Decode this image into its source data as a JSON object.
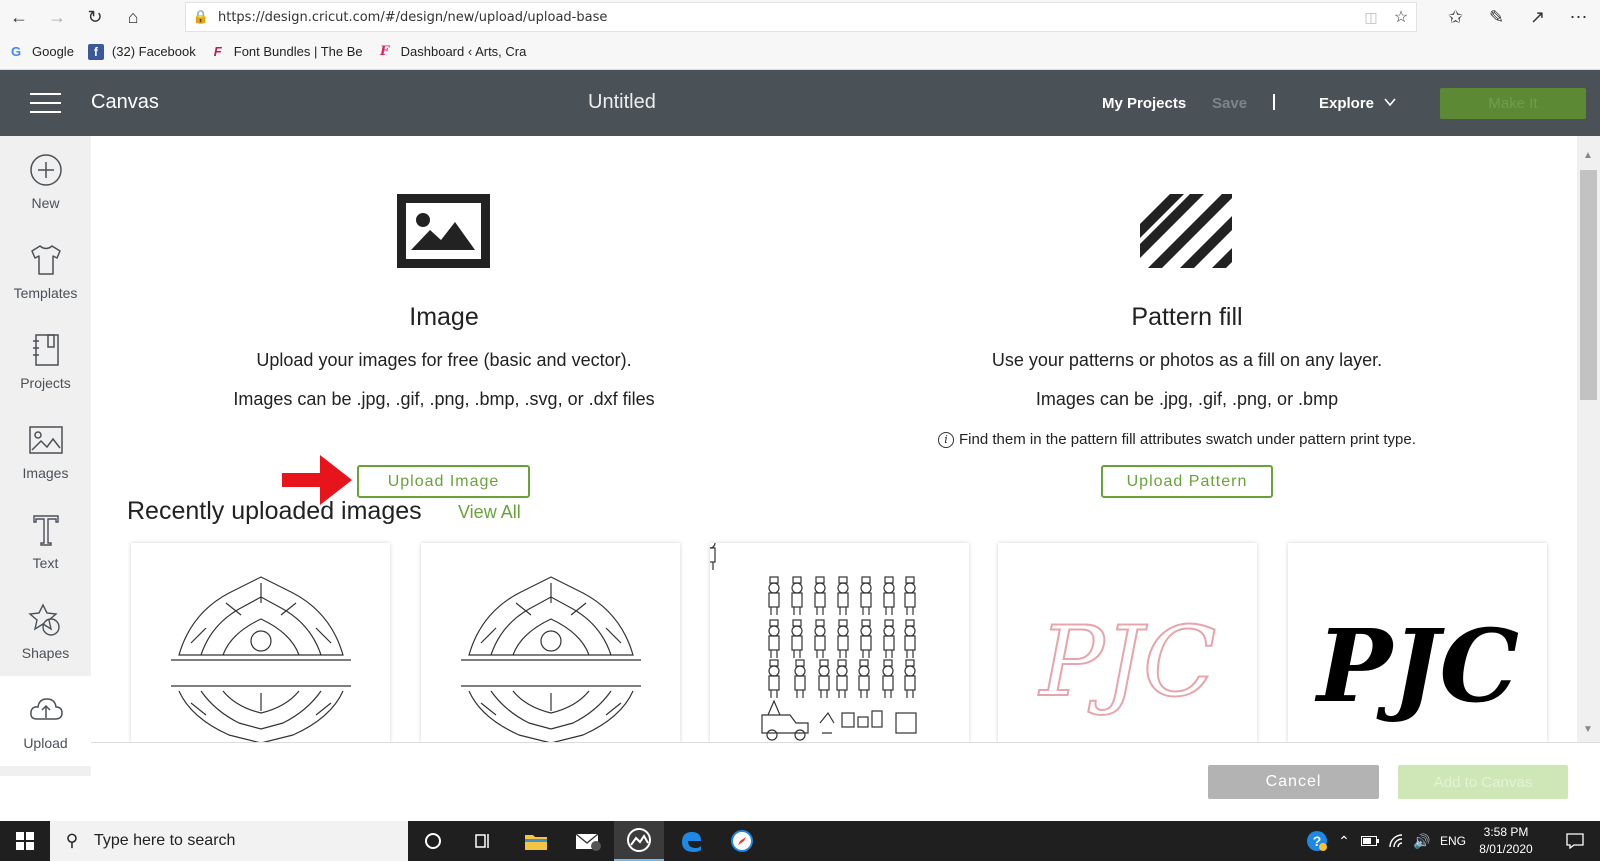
{
  "browser": {
    "url": "https://design.cricut.com/#/design/new/upload/upload-base",
    "bookmarks": [
      {
        "label": "Google",
        "icon": "google-icon"
      },
      {
        "label": "(32) Facebook",
        "icon": "facebook-icon"
      },
      {
        "label": "Font Bundles | The Be",
        "icon": "fontbundles-icon"
      },
      {
        "label": "Dashboard ‹ Arts, Cra",
        "icon": "wordpress-dashboard-icon"
      }
    ]
  },
  "header": {
    "app_title": "Canvas",
    "doc_title": "Untitled",
    "my_projects": "My Projects",
    "save": "Save",
    "separator": "|",
    "explore": "Explore",
    "make_it": "Make It"
  },
  "sidebar": {
    "items": [
      {
        "label": "New",
        "icon": "plus-circle-icon"
      },
      {
        "label": "Templates",
        "icon": "tshirt-icon"
      },
      {
        "label": "Projects",
        "icon": "notebook-icon"
      },
      {
        "label": "Images",
        "icon": "image-icon"
      },
      {
        "label": "Text",
        "icon": "text-icon"
      },
      {
        "label": "Shapes",
        "icon": "shapes-icon"
      },
      {
        "label": "Upload",
        "icon": "cloud-upload-icon"
      }
    ]
  },
  "image_section": {
    "title": "Image",
    "line1": "Upload your images for free (basic and vector).",
    "line2": "Images can be .jpg, .gif, .png, .bmp, .svg, or .dxf files",
    "button": "Upload Image"
  },
  "pattern_section": {
    "title": "Pattern fill",
    "line1": "Use your patterns or photos as a fill on any layer.",
    "line2": "Images can be .jpg, .gif, .png, or .bmp",
    "note": "Find them in the pattern fill attributes swatch under pattern print type.",
    "button": "Upload Pattern"
  },
  "recent": {
    "title": "Recently uploaded images",
    "view_all": "View All",
    "thumbnails": [
      {
        "kind": "split-mandala"
      },
      {
        "kind": "split-mandala"
      },
      {
        "kind": "nutcracker-set"
      },
      {
        "kind": "monogram-outline",
        "text": "PJC"
      },
      {
        "kind": "monogram-solid",
        "text": "PJC"
      }
    ]
  },
  "footer": {
    "cancel": "Cancel",
    "add": "Add to Canvas"
  },
  "taskbar": {
    "search_placeholder": "Type here to search",
    "language": "ENG",
    "time": "3:58 PM",
    "date": "8/01/2020",
    "mail_badge": "7"
  },
  "colors": {
    "header_bg": "#4a5157",
    "accent_green": "#6aa23a",
    "make_it_bg": "#5c8a34",
    "arrow_red": "#e8141c"
  }
}
